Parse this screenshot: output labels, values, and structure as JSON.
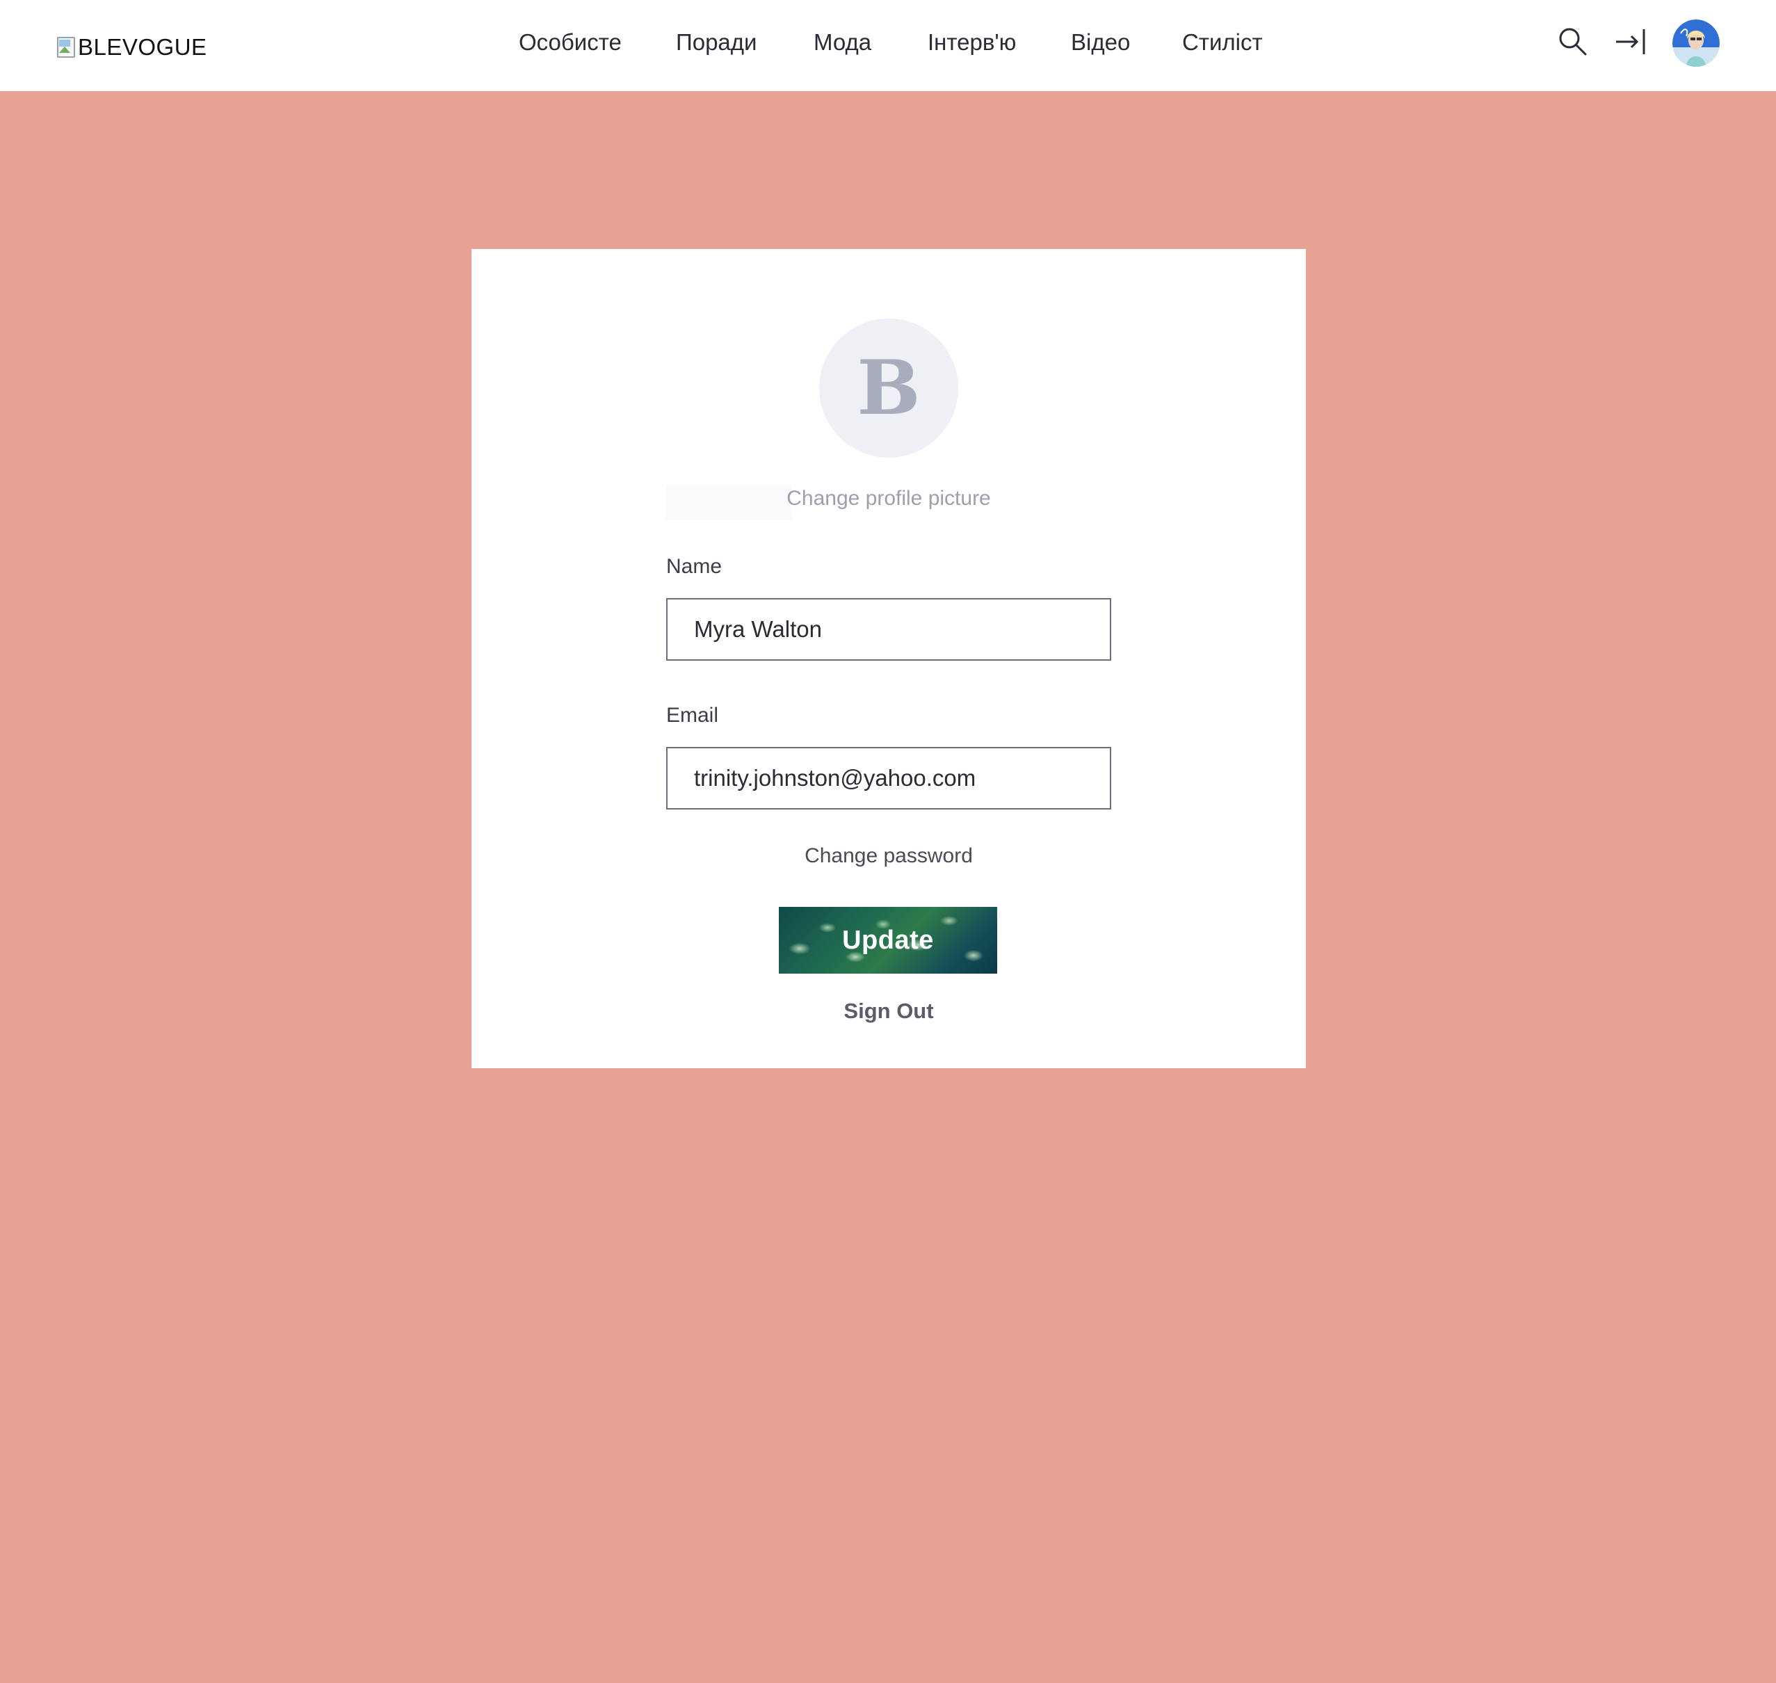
{
  "header": {
    "logo_alt": "BLEVOGUE",
    "nav": [
      {
        "label": "Особисте"
      },
      {
        "label": "Поради"
      },
      {
        "label": "Мода"
      },
      {
        "label": "Інтерв'ю"
      },
      {
        "label": "Відео"
      },
      {
        "label": "Стиліст"
      }
    ],
    "icons": {
      "search": "search-icon",
      "login": "login-arrow-icon",
      "avatar": "user-avatar"
    }
  },
  "profile": {
    "initial": "B",
    "change_picture_label": "Change profile picture",
    "name_label": "Name",
    "name_value": "Myra Walton",
    "email_label": "Email",
    "email_value": "trinity.johnston@yahoo.com",
    "change_password_label": "Change password",
    "update_label": "Update",
    "sign_out_label": "Sign Out"
  },
  "colors": {
    "page_background": "#e8a193",
    "card_background": "#ffffff",
    "header_background": "#ffffff",
    "avatar_placeholder_bg": "#eef0f6",
    "avatar_placeholder_text": "#a8adbd"
  }
}
